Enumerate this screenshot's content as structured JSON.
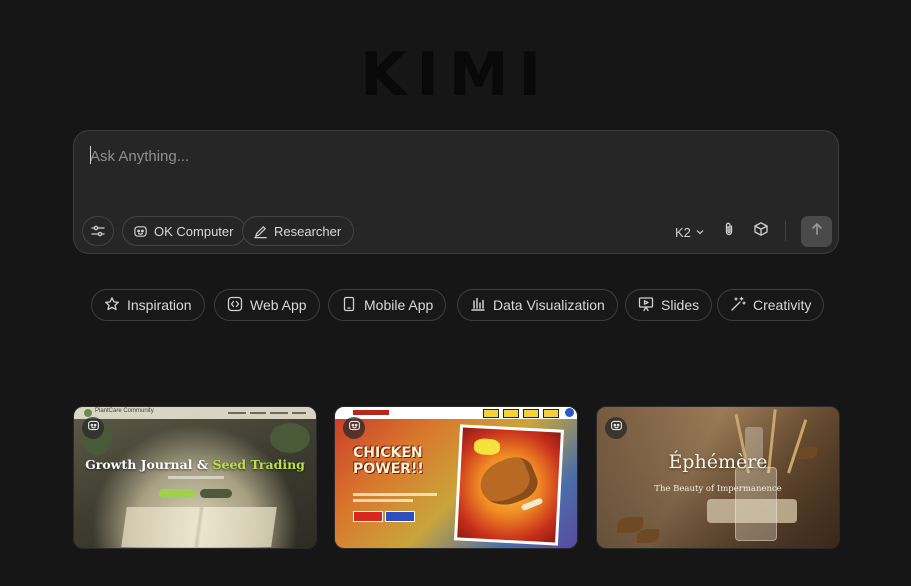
{
  "logo": {
    "text": "KIMI"
  },
  "composer": {
    "placeholder": "Ask Anything...",
    "tools": [
      {
        "icon": "sliders-icon",
        "label": ""
      },
      {
        "icon": "robot-icon",
        "label": "OK Computer"
      },
      {
        "icon": "pen-search-icon",
        "label": "Researcher"
      }
    ],
    "model": "K2",
    "attach_icon": "paperclip-icon",
    "cube_icon": "cube-icon",
    "send_icon": "arrow-up-icon"
  },
  "categories": [
    {
      "icon": "star-icon",
      "label": "Inspiration"
    },
    {
      "icon": "code-icon",
      "label": "Web App"
    },
    {
      "icon": "phone-icon",
      "label": "Mobile App"
    },
    {
      "icon": "bar-chart-icon",
      "label": "Data Visualization"
    },
    {
      "icon": "presentation-icon",
      "label": "Slides"
    },
    {
      "icon": "magic-wand-icon",
      "label": "Creativity"
    }
  ],
  "cards": [
    {
      "title_main": "Growth Journal & ",
      "title_accent": "Seed Trading",
      "nav_brand": "PlantCare Community",
      "badge_icon": "robot-icon"
    },
    {
      "headline": "CHICKEN POWER!!",
      "badge_icon": "robot-icon"
    },
    {
      "title": "Éphémère",
      "subtitle": "The Beauty of Impermanence",
      "badge_icon": "robot-icon"
    }
  ],
  "colors": {
    "background": "#161616",
    "composer_bg": "#262626",
    "accent_green": "#b8e04a"
  }
}
